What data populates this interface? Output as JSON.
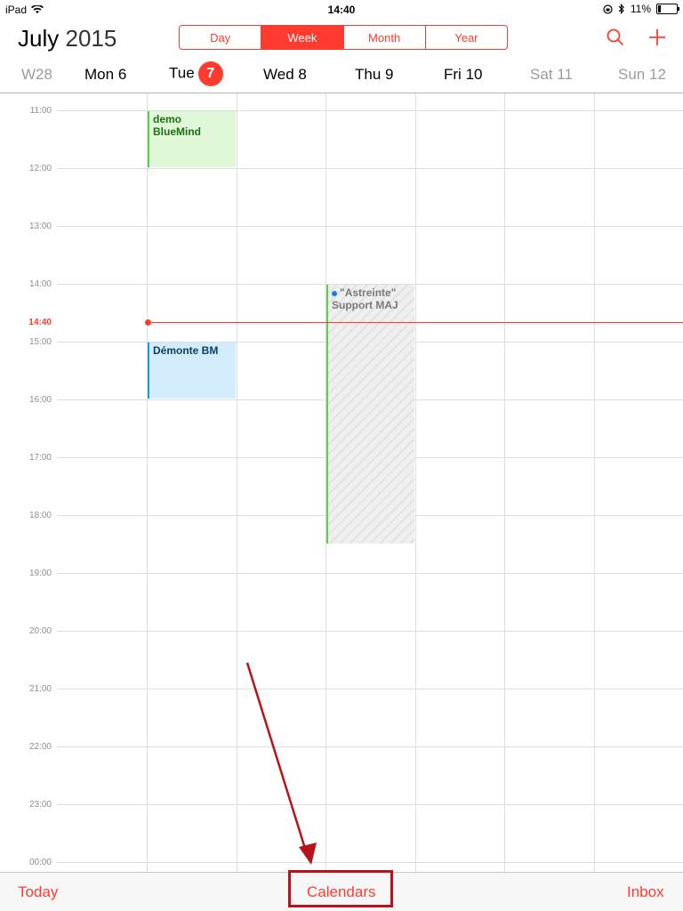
{
  "status": {
    "device": "iPad",
    "time": "14:40",
    "battery": "11%"
  },
  "header": {
    "month": "July",
    "year": "2015"
  },
  "view_switcher": [
    {
      "label": "Day",
      "active": false
    },
    {
      "label": "Week",
      "active": true
    },
    {
      "label": "Month",
      "active": false
    },
    {
      "label": "Year",
      "active": false
    }
  ],
  "toolbar_icons": [
    "search-icon",
    "add-icon"
  ],
  "week_number": "W28",
  "days": [
    {
      "name": "Mon",
      "num": "6"
    },
    {
      "name": "Tue",
      "num": "7",
      "today": true
    },
    {
      "name": "Wed",
      "num": "8"
    },
    {
      "name": "Thu",
      "num": "9"
    },
    {
      "name": "Fri",
      "num": "10"
    },
    {
      "name": "Sat",
      "num": "11"
    },
    {
      "name": "Sun",
      "num": "12"
    }
  ],
  "hours": [
    "11:00",
    "12:00",
    "13:00",
    "14:00",
    "15:00",
    "16:00",
    "17:00",
    "18:00",
    "19:00",
    "20:00",
    "21:00",
    "22:00",
    "23:00",
    "00:00"
  ],
  "now": "14:40",
  "events": [
    {
      "title": "demo BlueMind",
      "day": "Tue",
      "start": "11:00",
      "end": "12:00",
      "color": "#5bcf4c"
    },
    {
      "title": "Démonte BM",
      "day": "Tue",
      "start": "15:00",
      "end": "16:00",
      "color": "#1a9ce0"
    },
    {
      "title": "\"Astreinte\" Support MAJ",
      "day": "Thu",
      "start": "14:00",
      "end": "18:30",
      "color": "#5bcf4c"
    }
  ],
  "bottom": {
    "today": "Today",
    "calendars": "Calendars",
    "inbox": "Inbox"
  },
  "colors": {
    "accent": "#ff3b30",
    "annotation": "#b8121b"
  }
}
